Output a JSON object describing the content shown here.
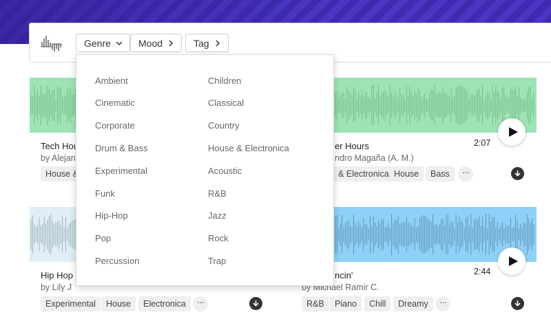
{
  "filters": {
    "genre_label": "Genre",
    "mood_label": "Mood",
    "tag_label": "Tag"
  },
  "genre_dropdown": {
    "left_column": [
      "Ambient",
      "Cinematic",
      "Corporate",
      "Drum & Bass",
      "Experimental",
      "Funk",
      "Hip-Hop",
      "Pop",
      "Percussion"
    ],
    "right_column": [
      "Children",
      "Classical",
      "Country",
      "House & Electronica",
      "Acoustic",
      "R&B",
      "Jazz",
      "Rock",
      "Trap"
    ]
  },
  "tracks": [
    {
      "title": "Tech Hou",
      "artist": "by Alejan",
      "tags": [
        "House &"
      ],
      "wave_color": "#9ee3b5"
    },
    {
      "title": "er Hours",
      "artist": "ndro Magaña (A. M.)",
      "duration": "2:07",
      "tags": [
        "& Electronica",
        "House",
        "Bass"
      ],
      "wave_color": "#9ee3b5"
    },
    {
      "title": "Hip Hop C",
      "artist": "by Lily J",
      "tags": [
        "Experimental",
        "House",
        "Electronica"
      ],
      "wave_color": "#dfeef5"
    },
    {
      "title": "ncin'",
      "artist": "by Michael Ramir C.",
      "duration": "2:44",
      "tags": [
        "R&B",
        "Piano",
        "Chill",
        "Dreamy"
      ],
      "wave_color": "#8fd0f6"
    }
  ],
  "more_label": "···",
  "icons": {
    "logo": "waveform-logo-icon",
    "dropdown": "chevron-down-icon",
    "submenu": "chevron-right-icon",
    "play": "play-icon",
    "download": "download-icon"
  }
}
